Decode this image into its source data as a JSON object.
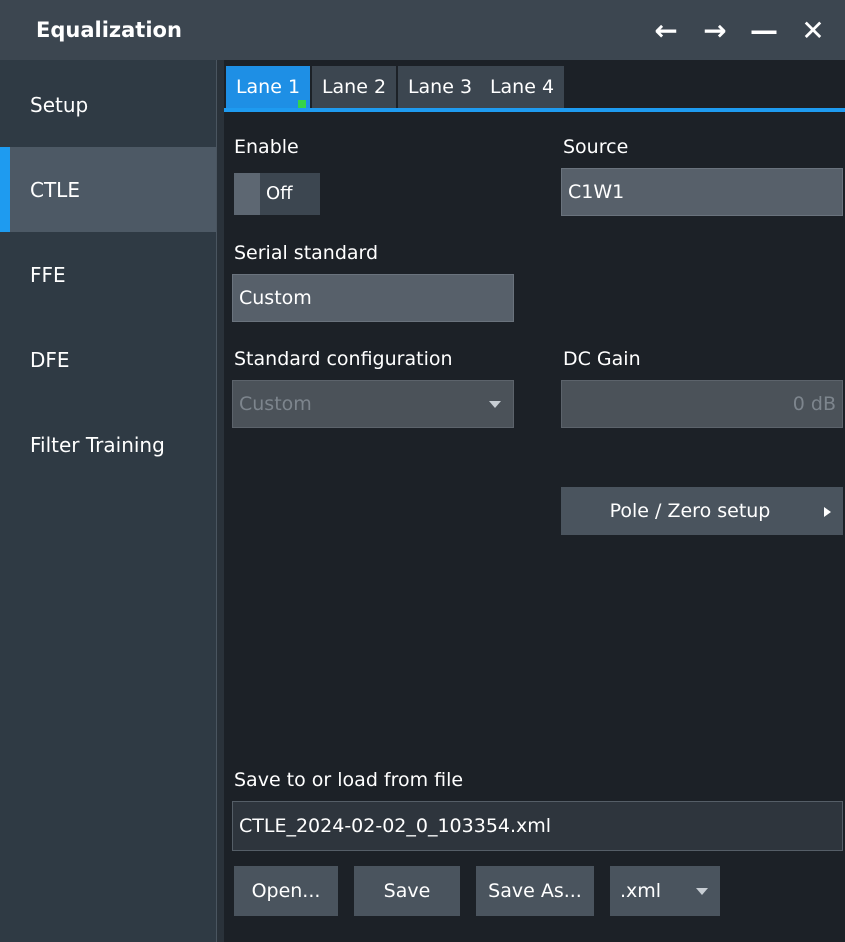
{
  "window": {
    "title": "Equalization",
    "controls": [
      {
        "icon": "arrow-left-icon",
        "glyph": "←"
      },
      {
        "icon": "arrow-right-icon",
        "glyph": "→"
      },
      {
        "icon": "minimize-icon",
        "glyph": "—"
      },
      {
        "icon": "close-icon",
        "glyph": "✕"
      }
    ]
  },
  "sidebar": {
    "items": [
      {
        "label": "Setup"
      },
      {
        "label": "CTLE",
        "active": true
      },
      {
        "label": "FFE"
      },
      {
        "label": "DFE"
      },
      {
        "label": "Filter Training"
      }
    ]
  },
  "tabs": [
    {
      "label": "Lane 1",
      "active": true
    },
    {
      "label": "Lane 2"
    },
    {
      "label": "Lane 3"
    },
    {
      "label": "Lane 4"
    }
  ],
  "form": {
    "enable_label": "Enable",
    "enable_value": "Off",
    "source_label": "Source",
    "source_value": "C1W1",
    "serial_standard_label": "Serial standard",
    "serial_standard_value": "Custom",
    "standard_config_label": "Standard configuration",
    "standard_config_value": "Custom",
    "dc_gain_label": "DC Gain",
    "dc_gain_value": "0 dB",
    "pole_zero_button": "Pole / Zero setup"
  },
  "file": {
    "label": "Save to or load from file",
    "filename": "CTLE_2024-02-02_0_103354.xml",
    "open_button": "Open...",
    "save_button": "Save",
    "save_as_button": "Save As...",
    "format_value": ".xml"
  },
  "colors": {
    "accent": "#1e9bf0",
    "lane_active_indicator": "#35d44a"
  }
}
